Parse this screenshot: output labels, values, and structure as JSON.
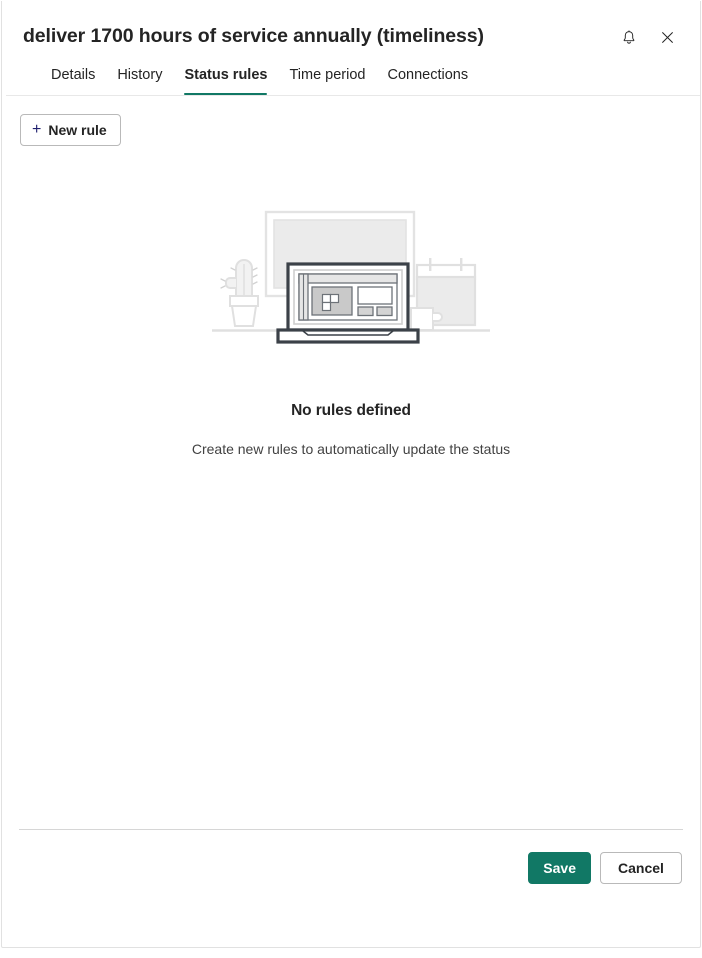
{
  "theme": {
    "accent": "#117865",
    "text_primary": "#242424",
    "text_secondary": "#424242",
    "border": "#e1e1e1",
    "button_border": "#b9b9b9",
    "plus_icon_color": "#1f1f6e",
    "illustration_light": "#e8e8e8",
    "illustration_mid": "#d6d6d6",
    "illustration_dark": "#3b4148",
    "illustration_gray": "#8a8f94"
  },
  "header": {
    "title": "deliver 1700 hours of service annually (timeliness)",
    "actions": [
      {
        "name": "notifications-button",
        "icon": "bell-icon",
        "tooltip": "Notifications"
      },
      {
        "name": "close-button",
        "icon": "close-icon",
        "tooltip": "Close"
      }
    ]
  },
  "tabs": [
    {
      "label": "Details",
      "active": false
    },
    {
      "label": "History",
      "active": false
    },
    {
      "label": "Status rules",
      "active": true
    },
    {
      "label": "Time period",
      "active": false
    },
    {
      "label": "Connections",
      "active": false
    }
  ],
  "toolbar": {
    "new_rule_label": "New rule",
    "new_rule_icon": "plus-icon",
    "plus_glyph": "+"
  },
  "empty_state": {
    "illustration": "empty-desk-illustration",
    "title": "No rules defined",
    "subtitle": "Create new rules to automatically update the status"
  },
  "footer": {
    "save_label": "Save",
    "cancel_label": "Cancel"
  },
  "icons": {
    "bell": "bell-icon",
    "close": "close-icon"
  }
}
